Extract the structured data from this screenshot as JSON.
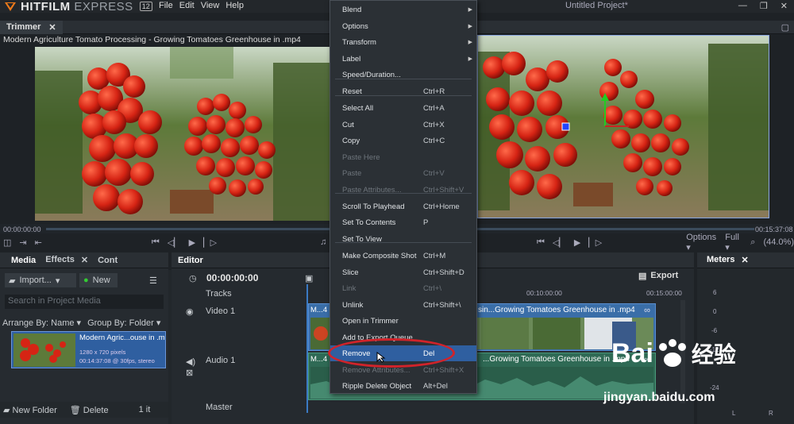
{
  "app": {
    "name": "HITFILM",
    "name_suffix": "EXPRESS",
    "version": "12",
    "menu": [
      "File",
      "Edit",
      "View",
      "Help"
    ],
    "project_title": "Untitled Project*",
    "win_controls": [
      "—",
      "❐",
      "✕"
    ]
  },
  "trimmer": {
    "tab": "Trimmer",
    "clip_title": "Modern Agriculture Tomato Processing - Growing Tomatoes Greenhouse in .mp4",
    "time_start": "00:00:00:00",
    "time_end": "00:15:37:08",
    "fit_label": "Fu"
  },
  "viewer": {
    "options": "Options",
    "fit": "Full",
    "zoom": "(44.0%)"
  },
  "media_panel": {
    "tabs": [
      "Media",
      "Effects",
      "Cont"
    ],
    "import": "Import...",
    "new": "New",
    "search_placeholder": "Search in Project Media",
    "arrange": "Arrange By: Name",
    "group": "Group By: Folder",
    "item": {
      "name": "Modern Agric...ouse in .m",
      "res": "1280 x 720 pixels",
      "info": "00:14:37:08 @ 30fps, stereo"
    },
    "new_folder": "New Folder",
    "delete": "Delete",
    "count": "1 it"
  },
  "editor": {
    "tab": "Editor",
    "timecode": "00:00:00:00",
    "export": "Export",
    "tracks_label": "Tracks",
    "video_track": "Video 1",
    "audio_track": "Audio 1",
    "master": "Master",
    "ruler": [
      "00:10:00:00",
      "00:15:00:00"
    ],
    "video_clip": "sin...Growing Tomatoes Greenhouse in .mp4",
    "audio_clip": "...Growing Tomatoes Greenhouse in .mp4",
    "clip_prefix": "M...4"
  },
  "meters": {
    "tab": "Meters",
    "scale": [
      "6",
      "0",
      "-6",
      "-12",
      "-24"
    ],
    "channels": [
      "L",
      "R"
    ]
  },
  "context_menu": {
    "items": [
      {
        "label": "Blend",
        "shortcut": "",
        "sub": true,
        "disabled": false
      },
      {
        "label": "Options",
        "shortcut": "",
        "sub": true,
        "disabled": false
      },
      {
        "label": "Transform",
        "shortcut": "",
        "sub": true,
        "disabled": false
      },
      {
        "label": "Label",
        "shortcut": "",
        "sub": true,
        "disabled": false
      },
      {
        "label": "Speed/Duration...",
        "shortcut": "",
        "sub": false,
        "disabled": false
      },
      {
        "label": "Reset",
        "shortcut": "Ctrl+R",
        "sub": false,
        "disabled": false
      },
      {
        "label": "Select All",
        "shortcut": "Ctrl+A",
        "sub": false,
        "disabled": false
      },
      {
        "label": "Cut",
        "shortcut": "Ctrl+X",
        "sub": false,
        "disabled": false
      },
      {
        "label": "Copy",
        "shortcut": "Ctrl+C",
        "sub": false,
        "disabled": false
      },
      {
        "label": "Paste Here",
        "shortcut": "",
        "sub": false,
        "disabled": true
      },
      {
        "label": "Paste",
        "shortcut": "Ctrl+V",
        "sub": false,
        "disabled": true
      },
      {
        "label": "Paste Attributes...",
        "shortcut": "Ctrl+Shift+V",
        "sub": false,
        "disabled": true
      },
      {
        "label": "Scroll To Playhead",
        "shortcut": "Ctrl+Home",
        "sub": false,
        "disabled": false
      },
      {
        "label": "Set To Contents",
        "shortcut": "P",
        "sub": false,
        "disabled": false
      },
      {
        "label": "Set To View",
        "shortcut": "",
        "sub": false,
        "disabled": false
      },
      {
        "label": "Make Composite Shot",
        "shortcut": "Ctrl+M",
        "sub": false,
        "disabled": false
      },
      {
        "label": "Slice",
        "shortcut": "Ctrl+Shift+D",
        "sub": false,
        "disabled": false
      },
      {
        "label": "Link",
        "shortcut": "Ctrl+\\",
        "sub": false,
        "disabled": true
      },
      {
        "label": "Unlink",
        "shortcut": "Ctrl+Shift+\\",
        "sub": false,
        "disabled": false
      },
      {
        "label": "Open in Trimmer",
        "shortcut": "",
        "sub": false,
        "disabled": false
      },
      {
        "label": "Add to Export Queue",
        "shortcut": "",
        "sub": false,
        "disabled": false
      },
      {
        "label": "Remove",
        "shortcut": "Del",
        "sub": false,
        "disabled": false,
        "highlight": true
      },
      {
        "label": "Remove Attributes...",
        "shortcut": "Ctrl+Shift+X",
        "sub": false,
        "disabled": true
      },
      {
        "label": "Ripple Delete Object",
        "shortcut": "Alt+Del",
        "sub": false,
        "disabled": false
      }
    ]
  },
  "watermark": {
    "brand": "Bai",
    "brand2": "经验",
    "url": "jingyan.baidu.com"
  },
  "colors": {
    "accent": "#2f5fa0",
    "highlight_oval": "#d1232a",
    "clip_video": "#3a6ea8",
    "clip_audio": "#2f6a55"
  }
}
